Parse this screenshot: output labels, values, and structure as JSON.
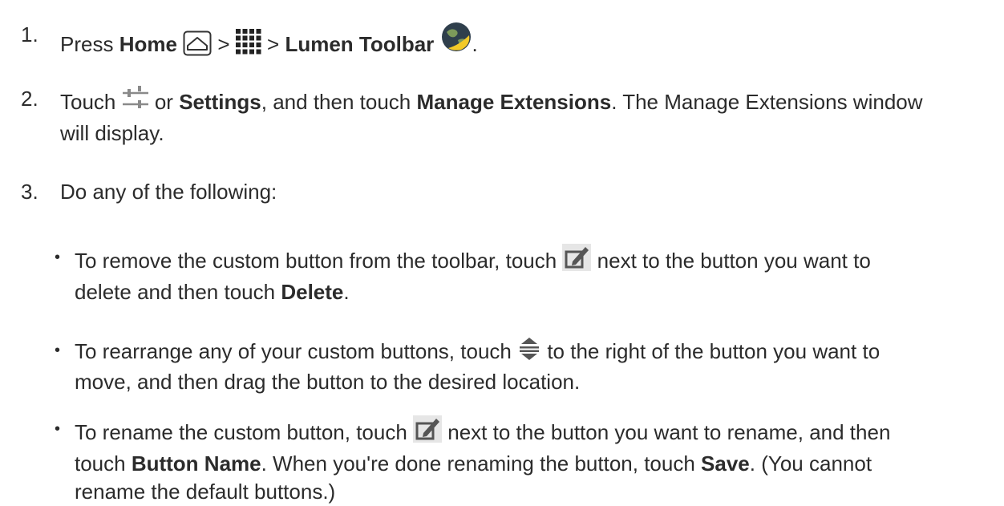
{
  "steps": [
    {
      "number": "1.",
      "parts": [
        "Press ",
        "Home",
        " > ",
        " > ",
        "Lumen Toolbar",
        "."
      ]
    },
    {
      "number": "2.",
      "parts": [
        "Touch ",
        " or ",
        "Settings",
        ", and then touch ",
        "Manage Extensions",
        ". The Manage Extensions window",
        "will display."
      ]
    },
    {
      "number": "3.",
      "parts": [
        "Do any of the following:"
      ]
    }
  ],
  "bullets": [
    {
      "parts": [
        "To remove the custom button from the toolbar, touch ",
        " next to the button you want to",
        "delete and then touch ",
        "Delete",
        "."
      ]
    },
    {
      "parts": [
        "To rearrange any of your custom buttons, touch ",
        " to the right of the button you want to",
        "move, and then drag the button to the desired location."
      ]
    },
    {
      "parts": [
        "To rename the custom button, touch ",
        " next to the button you want to rename, and then",
        "touch ",
        "Button Name",
        ". When you're done renaming the button, touch ",
        "Save",
        ". (You cannot",
        "rename the default buttons.)"
      ]
    }
  ],
  "icons": {
    "home": "home-icon",
    "apps": "apps-grid-icon",
    "lumen": "lumen-toolbar-globe-icon",
    "settings": "settings-sliders-icon",
    "edit": "edit-icon",
    "reorder": "reorder-handle-icon"
  },
  "colors": {
    "text": "#2b2b2b",
    "icon_gray": "#8a8a8a",
    "globe_yellow": "#f2c928"
  }
}
